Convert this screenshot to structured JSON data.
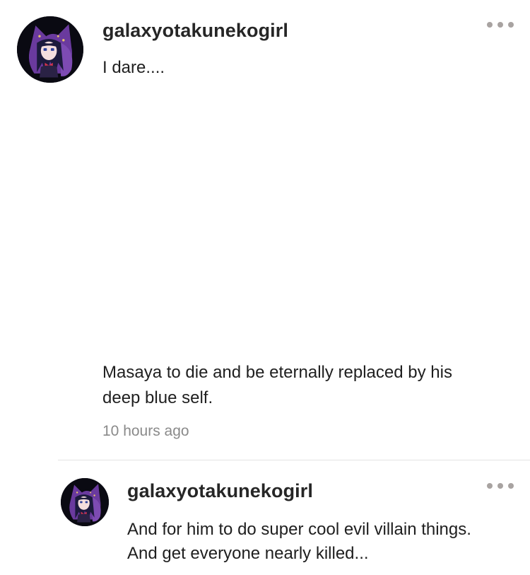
{
  "comment": {
    "username": "galaxyotakunekogirl",
    "text_line1": "I dare....",
    "text_line2": "Masaya to die and be eternally replaced by his",
    "text_line3": "deep blue self.",
    "timestamp": "10 hours ago",
    "more_icon": "ellipsis-icon",
    "avatar": "anime-girl-purple-hood"
  },
  "reply": {
    "username": "galaxyotakunekogirl",
    "text_line1": "And for him to do super cool evil villain things.",
    "text_line2": "And get everyone nearly killed...",
    "more_icon": "ellipsis-icon",
    "avatar": "anime-girl-purple-hood"
  },
  "colors": {
    "username": "#262626",
    "body_text": "#1f1f1f",
    "timestamp": "#8a8a8a",
    "dots": "#a8a3a1",
    "divider": "#e3e3e3",
    "avatar_bg": "#0a0a12",
    "hood": "#6a3a9e"
  }
}
